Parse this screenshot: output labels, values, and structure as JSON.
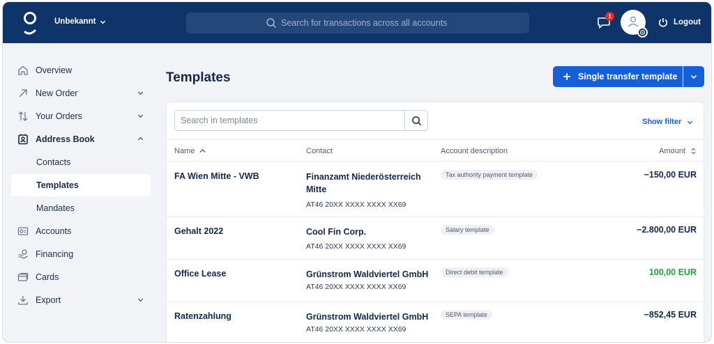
{
  "topbar": {
    "workspace": "Unbekannt",
    "search_placeholder": "Search for transactions across all accounts",
    "notifications_count": "1",
    "logout_label": "Logout"
  },
  "sidebar": {
    "items": [
      {
        "label": "Overview",
        "icon": "home-icon"
      },
      {
        "label": "New Order",
        "icon": "arrow-up-right-icon"
      },
      {
        "label": "Your Orders",
        "icon": "swap-arrows-icon"
      },
      {
        "label": "Address Book",
        "icon": "contact-book-icon"
      },
      {
        "label": "Contacts"
      },
      {
        "label": "Templates"
      },
      {
        "label": "Mandates"
      },
      {
        "label": "Accounts",
        "icon": "account-card-icon"
      },
      {
        "label": "Financing",
        "icon": "financing-icon"
      },
      {
        "label": "Cards",
        "icon": "cards-icon"
      },
      {
        "label": "Export",
        "icon": "download-icon"
      }
    ]
  },
  "main": {
    "title": "Templates",
    "primary_button": "Single transfer template",
    "search_placeholder": "Search in templates",
    "show_filter": "Show filter",
    "columns": {
      "name": "Name",
      "contact": "Contact",
      "account_description": "Account description",
      "amount": "Amount"
    },
    "rows": [
      {
        "name": "FA Wien Mitte - VWB",
        "contact": "Finanzamt Niederösterreich Mitte",
        "iban": "AT46 20XX XXXX XXXX XX69",
        "tag": "Tax authority payment template",
        "amount": "−150,00 EUR"
      },
      {
        "name": "Gehalt 2022",
        "contact": "Cool Fin Corp.",
        "iban": "AT46 20XX XXXX XXXX XX69",
        "tag": "Salary template",
        "amount": "−2.800,00 EUR"
      },
      {
        "name": "Office Lease",
        "contact": "Grünstrom Waldviertel GmbH",
        "iban": "AT46 20XX XXXX XXXX XX69",
        "tag": "Direct debit template",
        "amount": "100,00 EUR"
      },
      {
        "name": "Ratenzahlung",
        "contact": "Grünstrom Waldviertel GmbH",
        "iban": "AT46 20XX XXXX XXXX XX69",
        "tag": "SEPA template",
        "amount": "−852,45 EUR"
      }
    ]
  },
  "colors": {
    "topbar": "#0e3469",
    "primary": "#1560d9",
    "positive": "#20a13a",
    "badge": "#e02b2b"
  }
}
